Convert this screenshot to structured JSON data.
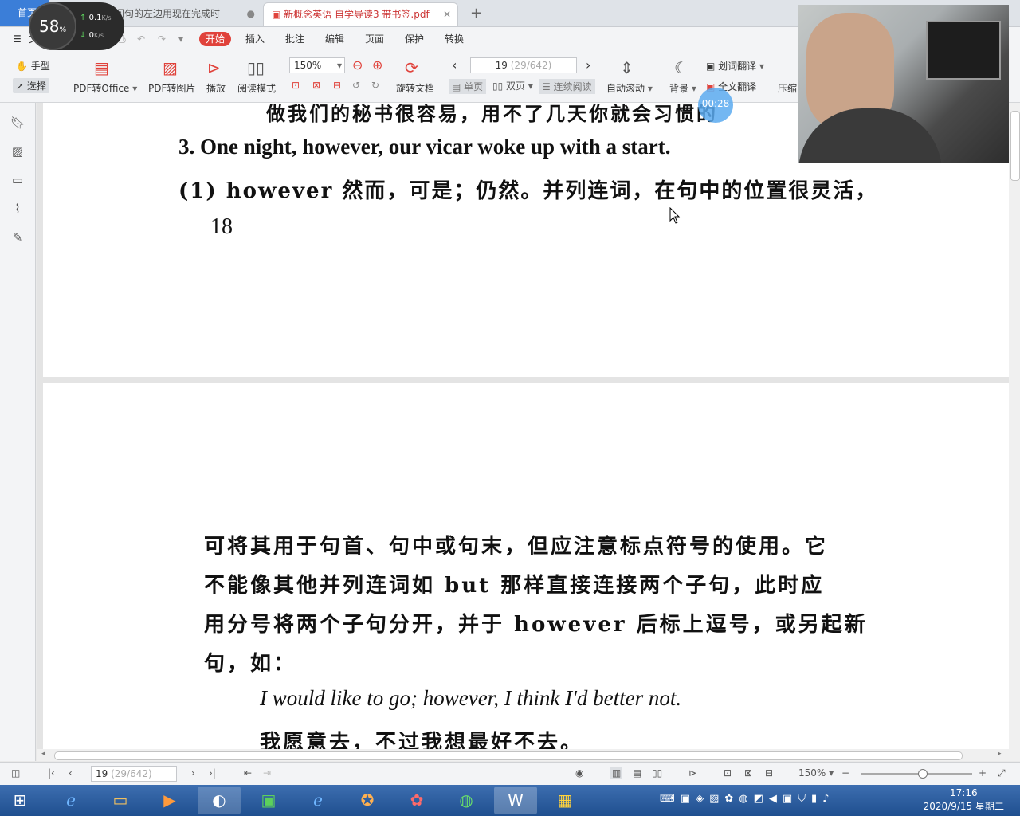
{
  "tabs": {
    "home": "首页",
    "doc1": "…所在问句的左边用现在完成时",
    "doc2": "新概念英语 自学导读3 带书签.pdf"
  },
  "menu": {
    "file": "文件",
    "start": "开始",
    "insert": "插入",
    "annotate": "批注",
    "edit": "编辑",
    "page": "页面",
    "protect": "保护",
    "convert": "转换"
  },
  "toolbar": {
    "hand": "手型",
    "select": "选择",
    "pdf_to_office": "PDF转Office",
    "pdf_to_image": "PDF转图片",
    "play": "播放",
    "read_mode": "阅读模式",
    "zoom": "150%",
    "rotate": "旋转文档",
    "page_input": "19",
    "page_total": "(29/642)",
    "single_page": "单页",
    "double_page": "双页",
    "continuous": "连续阅读",
    "auto_scroll": "自动滚动",
    "background": "背景",
    "word_translate": "划词翻译",
    "full_translate": "全文翻译",
    "compress": "压缩"
  },
  "speed": {
    "percent": "58",
    "percent_unit": "%",
    "up": "0.1",
    "down": "0",
    "unit": "K/s"
  },
  "timer": "00:28",
  "doc": {
    "p1_line0": "做我们的秘书很容易，用不了几天你就会习惯的",
    "p1_line1": "3. One night, however, our vicar woke up with a start.",
    "p1_line2": "(1) however 然而，可是；仍然。并列连词，在句中的位置很灵活，",
    "p1_pagenum": "18",
    "p2_line1": "可将其用于句首、句中或句末，但应注意标点符号的使用。它",
    "p2_line2": "不能像其他并列连词如 but 那样直接连接两个子句，此时应",
    "p2_line3": "用分号将两个子句分开，并于 however 后标上逗号，或另起新",
    "p2_line4": "句，如：",
    "p2_example_en": "I would like to go; however, I think I'd better not.",
    "p2_example_zh": "我愿意去，不过我想最好不去。"
  },
  "status": {
    "page_input": "19",
    "page_total": "(29/642)",
    "zoom": "150%",
    "zoom_fraction": 0.55
  },
  "clock": {
    "time": "17:16",
    "date": "2020/9/15 星期二"
  }
}
